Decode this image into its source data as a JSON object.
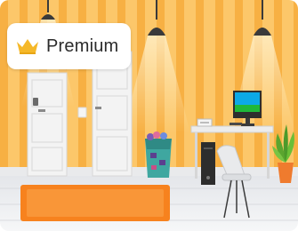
{
  "badge": {
    "label": "Premium",
    "icon": "crown-icon"
  },
  "scene": {
    "name": "office-room",
    "colors": {
      "wall_light": "#fcc76a",
      "wall_stripe": "#f7b043",
      "floor": "#f1f3f5",
      "rug": "#f7821e",
      "door": "#f2f2f2",
      "screen": "#0ca9e6",
      "screen_ground": "#1fb83a",
      "crown": "#f5b829"
    }
  }
}
